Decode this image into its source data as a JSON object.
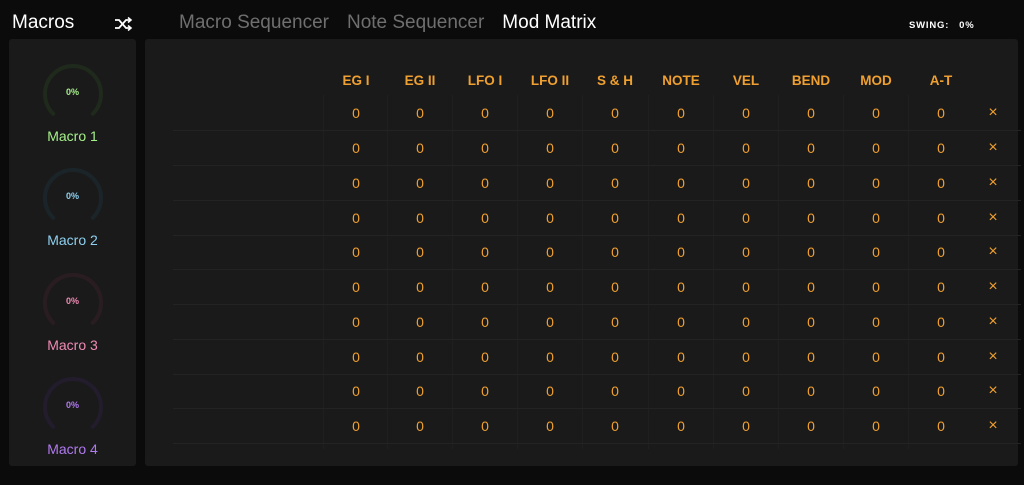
{
  "header": {
    "macros_title": "Macros",
    "shuffle_icon": "shuffle-icon",
    "tabs": [
      {
        "label": "Macro Sequencer",
        "active": false
      },
      {
        "label": "Note Sequencer",
        "active": false
      },
      {
        "label": "Mod Matrix",
        "active": true
      }
    ],
    "swing_label": "SWING:",
    "swing_value": "0%"
  },
  "macros": [
    {
      "label": "Macro 1",
      "value": "0%",
      "color": "#a6f08a",
      "track": "#1f2a1c"
    },
    {
      "label": "Macro 2",
      "value": "0%",
      "color": "#8fd0f0",
      "track": "#1b2529"
    },
    {
      "label": "Macro 3",
      "value": "0%",
      "color": "#f08ab4",
      "track": "#2a1d22"
    },
    {
      "label": "Macro 4",
      "value": "0%",
      "color": "#b07af0",
      "track": "#221c2c"
    }
  ],
  "matrix": {
    "columns": [
      "EG I",
      "EG II",
      "LFO I",
      "LFO II",
      "S & H",
      "NOTE",
      "VEL",
      "BEND",
      "MOD",
      "A-T"
    ],
    "rows": [
      [
        "0",
        "0",
        "0",
        "0",
        "0",
        "0",
        "0",
        "0",
        "0",
        "0"
      ],
      [
        "0",
        "0",
        "0",
        "0",
        "0",
        "0",
        "0",
        "0",
        "0",
        "0"
      ],
      [
        "0",
        "0",
        "0",
        "0",
        "0",
        "0",
        "0",
        "0",
        "0",
        "0"
      ],
      [
        "0",
        "0",
        "0",
        "0",
        "0",
        "0",
        "0",
        "0",
        "0",
        "0"
      ],
      [
        "0",
        "0",
        "0",
        "0",
        "0",
        "0",
        "0",
        "0",
        "0",
        "0"
      ],
      [
        "0",
        "0",
        "0",
        "0",
        "0",
        "0",
        "0",
        "0",
        "0",
        "0"
      ],
      [
        "0",
        "0",
        "0",
        "0",
        "0",
        "0",
        "0",
        "0",
        "0",
        "0"
      ],
      [
        "0",
        "0",
        "0",
        "0",
        "0",
        "0",
        "0",
        "0",
        "0",
        "0"
      ],
      [
        "0",
        "0",
        "0",
        "0",
        "0",
        "0",
        "0",
        "0",
        "0",
        "0"
      ],
      [
        "0",
        "0",
        "0",
        "0",
        "0",
        "0",
        "0",
        "0",
        "0",
        "0"
      ]
    ],
    "delete_glyph": "×",
    "delete_icon": "close-icon",
    "accent": "#f0a030"
  }
}
